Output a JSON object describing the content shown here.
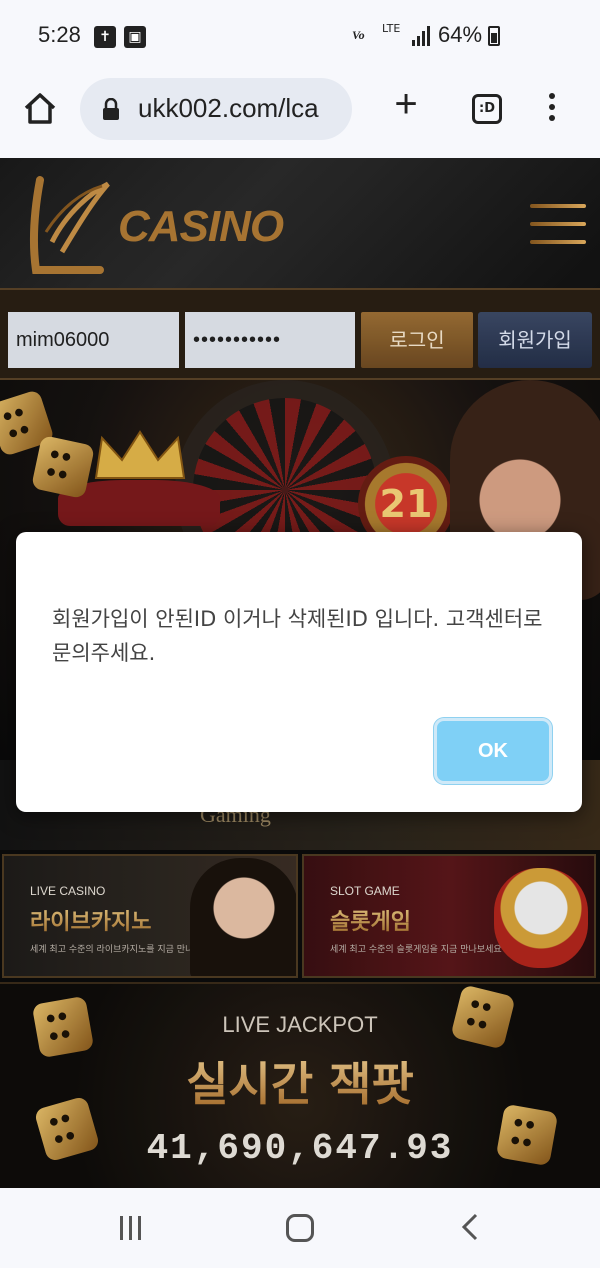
{
  "status_bar": {
    "time": "5:28",
    "network_label": "Vo",
    "lte_label": "LTE",
    "battery_percent": "64%",
    "battery_level": 0.64,
    "icons": [
      "cross-icon",
      "image-icon",
      "signal-icon",
      "battery-icon"
    ]
  },
  "browser": {
    "url": "ukk002.com/lca",
    "tabs_label": ":D",
    "icons": [
      "home-icon",
      "lock-icon",
      "plus-icon",
      "tabs-icon",
      "more-vert-icon"
    ]
  },
  "site": {
    "logo_text": "CASINO",
    "login": {
      "username": "mim06000",
      "password": "•••••••••••",
      "login_label": "로그인",
      "join_label": "회원가입"
    },
    "hero": {
      "badge": "21"
    },
    "promo": {
      "brand": "Gaming"
    },
    "cards": [
      {
        "eyebrow": "LIVE CASINO",
        "title": "라이브카지노",
        "desc": "세계 최고 수준의 라이브카지노를 지금 만나보세요"
      },
      {
        "eyebrow": "SLOT GAME",
        "title": "슬롯게임",
        "desc": "세계 최고 수준의 슬롯게임을 지금 만나보세요"
      }
    ],
    "jackpot": {
      "label": "LIVE JACKPOT",
      "headline": "실시간 잭팟",
      "amount": "41,690,647.93"
    }
  },
  "dialog": {
    "message": "회원가입이 안된ID 이거나 삭제된ID 입니다. 고객센터로 문의주세요.",
    "ok_label": "OK"
  },
  "colors": {
    "accent_gold": "#b07b35",
    "ok_button": "#7fd0f6",
    "join_button": "#3c4a66"
  }
}
